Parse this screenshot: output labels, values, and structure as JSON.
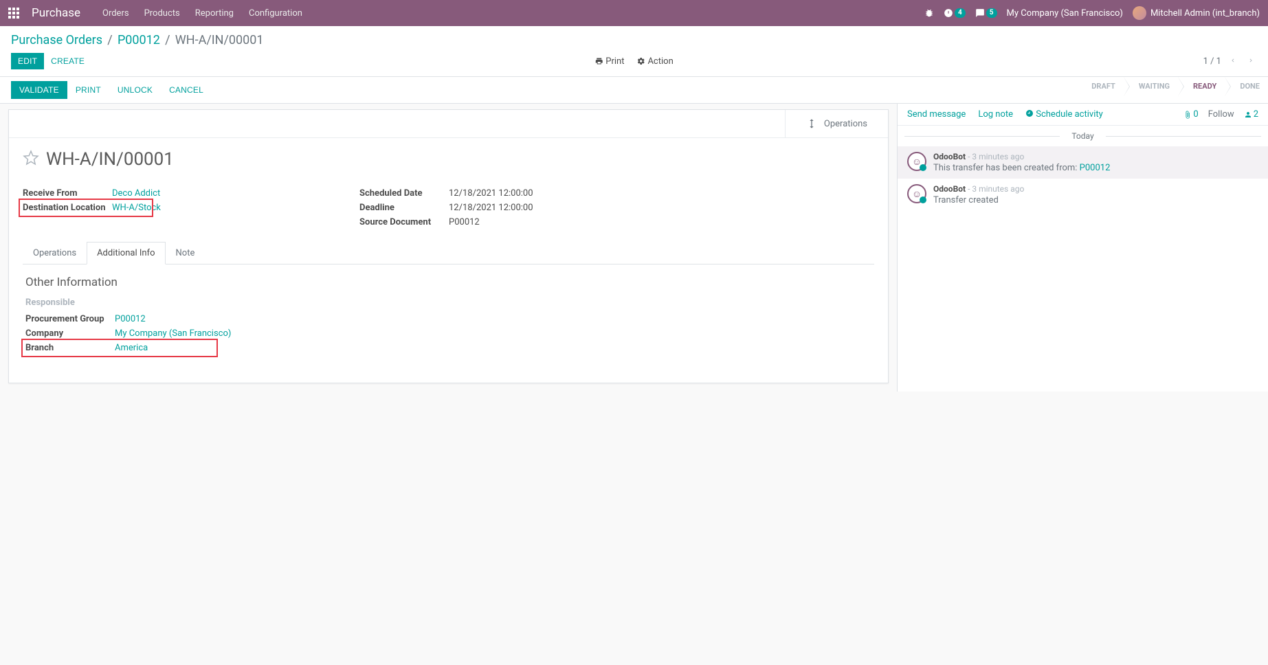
{
  "nav": {
    "app_title": "Purchase",
    "menu": [
      "Orders",
      "Products",
      "Reporting",
      "Configuration"
    ],
    "debug_badge": "4",
    "msg_badge": "5",
    "company": "My Company (San Francisco)",
    "user": "Mitchell Admin (int_branch)"
  },
  "breadcrumb": {
    "items": [
      "Purchase Orders",
      "P00012"
    ],
    "current": "WH-A/IN/00001"
  },
  "actions": {
    "edit": "EDIT",
    "create": "CREATE",
    "print": "Print",
    "action": "Action",
    "pager": "1 / 1"
  },
  "status": {
    "buttons": [
      "VALIDATE",
      "PRINT",
      "UNLOCK",
      "CANCEL"
    ],
    "steps": [
      "DRAFT",
      "WAITING",
      "READY",
      "DONE"
    ],
    "active_step": 2
  },
  "record": {
    "stat_button": "Operations",
    "title": "WH-A/IN/00001",
    "fields_left": {
      "receive_from_label": "Receive From",
      "receive_from_val": "Deco Addict",
      "dest_label": "Destination Location",
      "dest_val": "WH-A/Stock"
    },
    "fields_right": {
      "scheduled_label": "Scheduled Date",
      "scheduled_val": "12/18/2021 12:00:00",
      "deadline_label": "Deadline",
      "deadline_val": "12/18/2021 12:00:00",
      "source_label": "Source Document",
      "source_val": "P00012"
    },
    "tabs": [
      "Operations",
      "Additional Info",
      "Note"
    ],
    "active_tab": 1,
    "section_title": "Other Information",
    "responsible_label": "Responsible",
    "proc_label": "Procurement Group",
    "proc_val": "P00012",
    "company_label": "Company",
    "company_val": "My Company (San Francisco)",
    "branch_label": "Branch",
    "branch_val": "America"
  },
  "chatter": {
    "send": "Send message",
    "log": "Log note",
    "schedule": "Schedule activity",
    "attach_count": "0",
    "follow": "Follow",
    "followers": "2",
    "today": "Today",
    "messages": [
      {
        "author": "OdooBot",
        "ago": "- 3 minutes ago",
        "text_prefix": "This transfer has been created from: ",
        "link": "P00012",
        "highlight": true
      },
      {
        "author": "OdooBot",
        "ago": "- 3 minutes ago",
        "text_prefix": "Transfer created",
        "link": "",
        "highlight": false
      }
    ]
  }
}
